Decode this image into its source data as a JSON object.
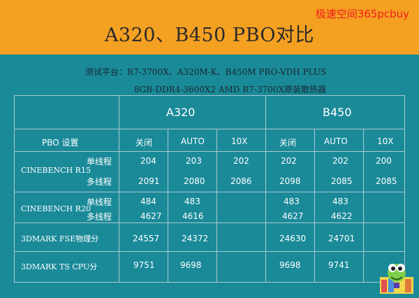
{
  "header": {
    "watermark": "极速空间365pcbuy",
    "title": "A320、B450 PBO对比"
  },
  "platform": {
    "line1": "测试平台：R7-3700X、A320M-K、B450M PRO-VDH PLUS",
    "line2": "8GB-DDR4-3600X2  AMD R7-3700X原装散热器"
  },
  "table": {
    "groups": [
      "A320",
      "B450"
    ],
    "settings_label": "PBO 设置",
    "settings": [
      "关闭",
      "AUTO",
      "10X",
      "关闭",
      "AUTO",
      "10X"
    ],
    "rows": [
      {
        "name": "CINEBENCH R15",
        "single_label": "单线程",
        "multi_label": "多线程",
        "single": [
          "204",
          "203",
          "202",
          "202",
          "202",
          "200"
        ],
        "multi": [
          "2091",
          "2080",
          "2086",
          "2098",
          "2085",
          "2085"
        ]
      },
      {
        "name": "CINEBENCH R20",
        "single_label": "单线程",
        "multi_label": "多线程",
        "single": [
          "484",
          "483",
          "",
          "483",
          "483",
          ""
        ],
        "multi": [
          "4627",
          "4616",
          "",
          "4627",
          "4622",
          ""
        ]
      },
      {
        "name": "3DMARK FSE物理分",
        "values": [
          "24557",
          "24372",
          "",
          "24630",
          "24701",
          ""
        ]
      },
      {
        "name": "3DMARK TS CPU分",
        "values": [
          "9751",
          "9698",
          "",
          "9698",
          "9741",
          ""
        ]
      }
    ]
  },
  "colors": {
    "background": "#1a8a99",
    "header": "#f4a021",
    "watermark": "#f21c1c",
    "grid": "#aac9cf"
  }
}
